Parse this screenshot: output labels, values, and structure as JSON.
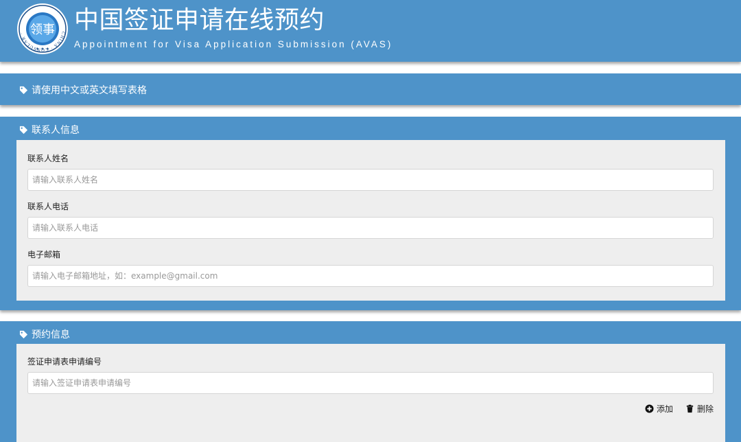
{
  "header": {
    "title": "中国签证申请在线预约",
    "subtitle": "Appointment for Visa Application Submission (AVAS)",
    "logo_text": "CHINA · CONSULAR · AFFAIRS"
  },
  "notice": {
    "text": "请使用中文或英文填写表格"
  },
  "contact": {
    "heading": "联系人信息",
    "name_label": "联系人姓名",
    "name_placeholder": "请输入联系人姓名",
    "phone_label": "联系人电话",
    "phone_placeholder": "请输入联系人电话",
    "email_label": "电子邮箱",
    "email_placeholder": "请输入电子邮箱地址，如：example@gmail.com"
  },
  "appointment": {
    "heading": "预约信息",
    "form_no_label": "签证申请表申请编号",
    "form_no_placeholder": "请输入签证申请表申请编号",
    "add_label": "添加",
    "delete_label": "删除"
  },
  "colors": {
    "brand_blue": "#4e93c9",
    "panel_gray": "#eeeeee"
  }
}
